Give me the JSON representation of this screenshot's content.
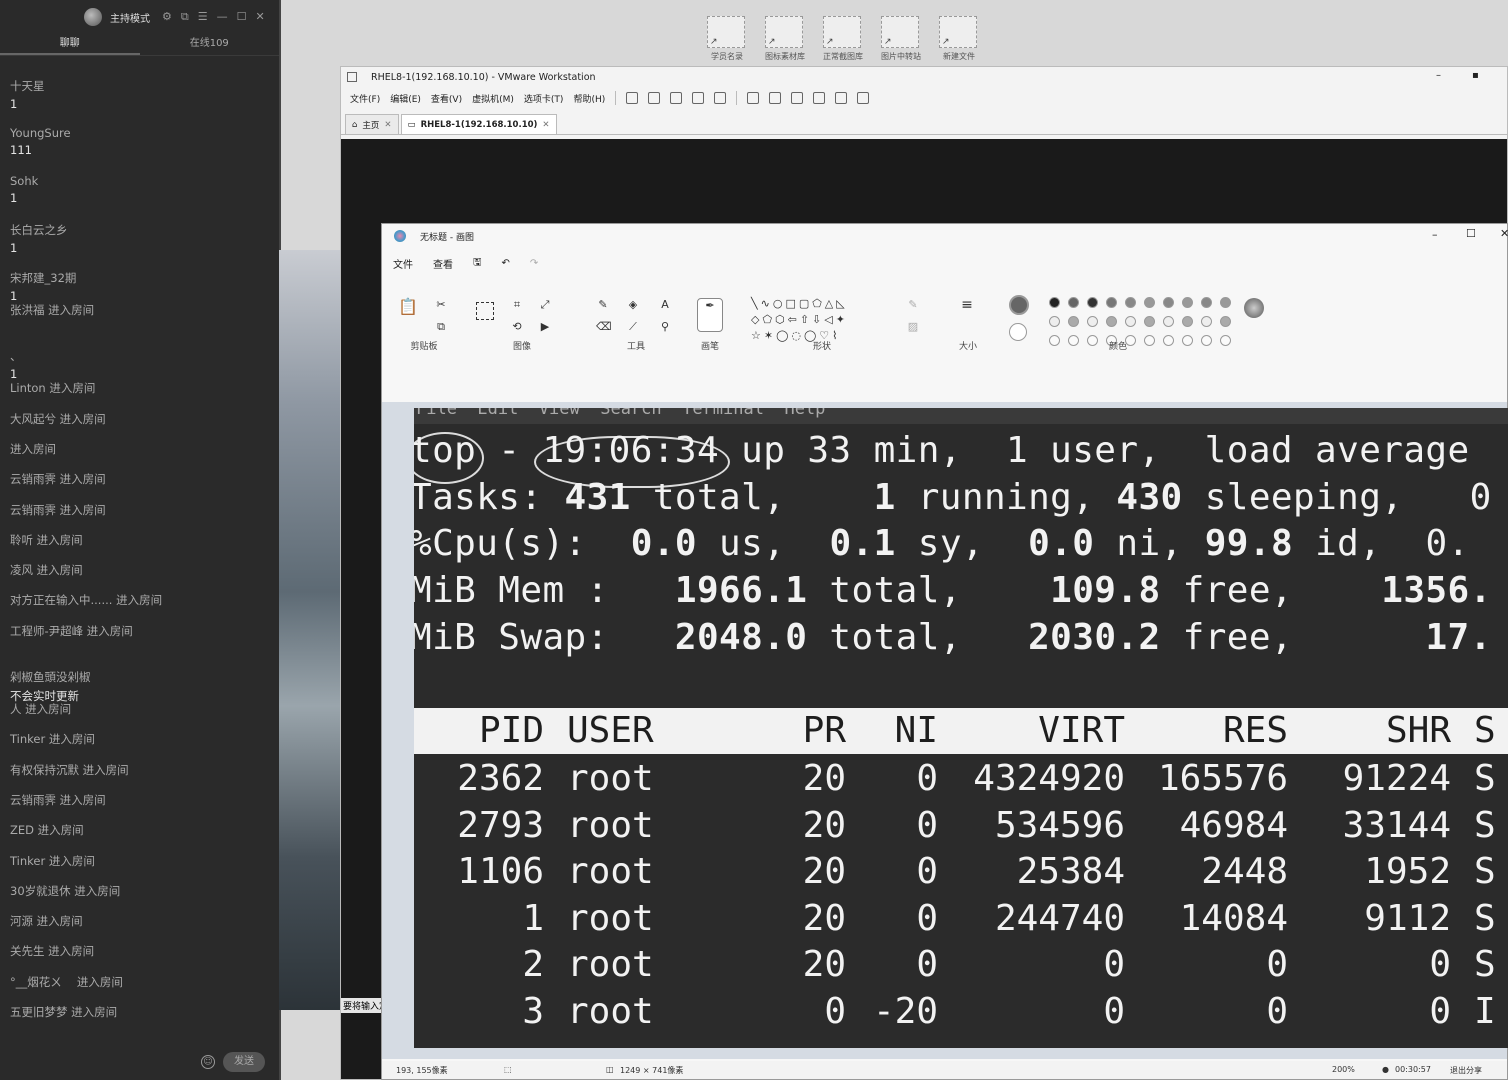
{
  "chat": {
    "title": "主持模式",
    "tabs": [
      "聊聊",
      "在线109"
    ],
    "messages": [
      {
        "name": "十天星",
        "text": "1"
      },
      {
        "name": "YoungSure",
        "text": "111"
      },
      {
        "name": "Sohk",
        "text": "1"
      },
      {
        "name": "长白云之乡",
        "text": "1"
      },
      {
        "name": "宋邦建_32期",
        "text": "1"
      },
      {
        "event": "张洪福 进入房间"
      },
      {
        "name": "、",
        "text": "1"
      },
      {
        "event": "Linton 进入房间"
      },
      {
        "event": "大风起兮 进入房间"
      },
      {
        "event": "进入房间"
      },
      {
        "event": "云销雨霁 进入房间"
      },
      {
        "event": "云销雨霁 进入房间"
      },
      {
        "event": "聆听 进入房间"
      },
      {
        "event": "凌风 进入房间"
      },
      {
        "event": "对方正在输入中...... 进入房间"
      },
      {
        "event": "工程师-尹超峰 进入房间"
      },
      {
        "name": "剁椒鱼頭没剁椒",
        "text": "不会实时更新"
      },
      {
        "event": "人 进入房间"
      },
      {
        "event": "Tinker 进入房间"
      },
      {
        "event": "有权保持沉默 进入房间"
      },
      {
        "event": "云销雨霁 进入房间"
      },
      {
        "event": "ZED 进入房间"
      },
      {
        "event": "Tinker 进入房间"
      },
      {
        "event": "30岁就退休 进入房间"
      },
      {
        "event": "河源 进入房间"
      },
      {
        "event": "关先生 进入房间"
      },
      {
        "event": "°__烟花ㄨ　 进入房间"
      },
      {
        "event": "五更旧梦梦 进入房间"
      }
    ],
    "send_label": "发送"
  },
  "desktop": {
    "shortcuts": [
      "学员名录",
      "图标素材库",
      "正常截图库",
      "图片中转站",
      "新建文件"
    ]
  },
  "vmware": {
    "title": "RHEL8-1(192.168.10.10) - VMware Workstation",
    "menus": [
      "文件(F)",
      "编辑(E)",
      "查看(V)",
      "虚拟机(M)",
      "选项卡(T)",
      "帮助(H)"
    ],
    "tabs": [
      "主页",
      "RHEL8-1(192.168.10.10)"
    ],
    "overlay_label": "要将输入定"
  },
  "paint": {
    "title": "无标题 - 画图",
    "menus": [
      "文件",
      "查看"
    ],
    "groups": [
      "剪贴板",
      "图像",
      "工具",
      "画笔",
      "形状",
      "大小",
      "颜色"
    ],
    "status": {
      "cursor": "193, 155像素",
      "size": "1249 × 741像素",
      "zoom": "200%",
      "timer": "00:30:57",
      "exit_share": "退出分享"
    }
  },
  "terminal": {
    "menu_text": "File  Edit  View  Search  Terminal  Help",
    "summary": [
      {
        "label": "top - ",
        "time": "19:06:34",
        "rest": " up 33 min,  1 user,  load average"
      },
      {
        "label": "Tasks: ",
        "v1": "431",
        "t1": " total,    ",
        "v2": "1",
        "t2": " running, ",
        "v3": "430",
        "t3": " sleeping,   0"
      },
      {
        "label": "%Cpu(s):  ",
        "v1": "0.0",
        "t1": " us,  ",
        "v2": "0.1",
        "t2": " sy,  ",
        "v3": "0.0",
        "t3": " ni, ",
        "v4": "99.8",
        "t4": " id,  0."
      },
      {
        "label": "MiB Mem :   ",
        "v1": "1966.1",
        "t1": " total,    ",
        "v2": "109.8",
        "t2": " free,    ",
        "v3": "1356."
      },
      {
        "label": "MiB Swap:   ",
        "v1": "2048.0",
        "t1": " total,   ",
        "v2": "2030.2",
        "t2": " free,      ",
        "v3": "17."
      }
    ],
    "columns": [
      "PID",
      "USER",
      "PR",
      "NI",
      "VIRT",
      "RES",
      "SHR",
      "S"
    ],
    "rows": [
      [
        "2362",
        "root",
        "20",
        "0",
        "4324920",
        "165576",
        "91224",
        "S"
      ],
      [
        "2793",
        "root",
        "20",
        "0",
        "534596",
        "46984",
        "33144",
        "S"
      ],
      [
        "1106",
        "root",
        "20",
        "0",
        "25384",
        "2448",
        "1952",
        "S"
      ],
      [
        "1",
        "root",
        "20",
        "0",
        "244740",
        "14084",
        "9112",
        "S"
      ],
      [
        "2",
        "root",
        "20",
        "0",
        "0",
        "0",
        "0",
        "S"
      ],
      [
        "3",
        "root",
        "0",
        "-20",
        "0",
        "0",
        "0",
        "I"
      ]
    ]
  }
}
